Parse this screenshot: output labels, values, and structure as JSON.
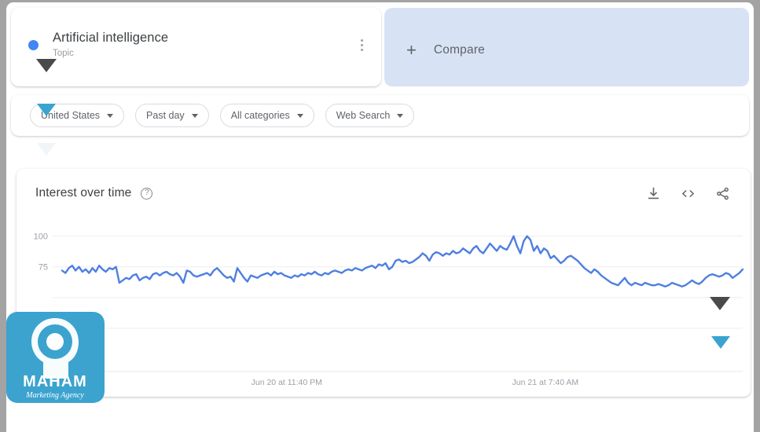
{
  "topbar": {
    "term": {
      "title": "Artificial intelligence",
      "subtitle": "Topic",
      "dot_color": "#4285f4",
      "menu_icon": "kebab-menu-icon"
    },
    "compare": {
      "label": "Compare",
      "plus": "+",
      "background": "#d7e3f4"
    }
  },
  "filters": [
    {
      "label": "United States",
      "caret": "▾"
    },
    {
      "label": "Past day",
      "caret": "▾"
    },
    {
      "label": "All categories",
      "caret": "▾"
    },
    {
      "label": "Web Search",
      "caret": "▾"
    }
  ],
  "chart_card": {
    "title": "Interest over time",
    "help": "?",
    "actions": [
      {
        "name": "download-icon"
      },
      {
        "name": "embed-code-icon"
      },
      {
        "name": "share-icon"
      }
    ]
  },
  "cursors": [
    {
      "name": "cursor-triangle-term",
      "color": "#4a4a4a"
    },
    {
      "name": "cursor-triangle-region",
      "color": "#3ba3d0"
    },
    {
      "name": "cursor-triangle-below-filters",
      "color": "#f2f5f8"
    },
    {
      "name": "cursor-triangle-plot-dark",
      "color": "#4a4a4a"
    },
    {
      "name": "cursor-triangle-plot-blue",
      "color": "#3ba3d0"
    }
  ],
  "watermark": {
    "brand": "MAHAM",
    "tagline": "Marketing Agency",
    "color": "#3ba3ce"
  },
  "chart_data": {
    "type": "line",
    "title": "Interest over time",
    "xlabel": "",
    "ylabel": "",
    "ylim": [
      0,
      110
    ],
    "yticks": [
      75,
      100
    ],
    "ytick_labels": [
      "75",
      "100"
    ],
    "grid": true,
    "legend": false,
    "line_color": "#4e7fe0",
    "xtick_labels": [
      "Jun 20 at 11:40 PM",
      "Jun 21 at 7:40 AM"
    ],
    "xtick_positions": [
      0.33,
      0.71
    ],
    "series": [
      {
        "name": "Artificial intelligence",
        "values": [
          72,
          70,
          74,
          76,
          72,
          75,
          71,
          73,
          70,
          74,
          71,
          76,
          73,
          71,
          74,
          73,
          75,
          62,
          64,
          66,
          65,
          68,
          69,
          64,
          66,
          67,
          65,
          69,
          70,
          68,
          70,
          71,
          69,
          68,
          70,
          67,
          62,
          72,
          71,
          68,
          67,
          68,
          69,
          70,
          68,
          72,
          74,
          71,
          68,
          66,
          67,
          63,
          74,
          70,
          66,
          63,
          68,
          67,
          66,
          68,
          69,
          70,
          68,
          71,
          69,
          70,
          68,
          67,
          66,
          68,
          67,
          69,
          68,
          70,
          69,
          71,
          69,
          68,
          70,
          69,
          71,
          72,
          71,
          70,
          72,
          73,
          72,
          74,
          73,
          72,
          74,
          75,
          76,
          74,
          77,
          76,
          78,
          73,
          75,
          80,
          81,
          79,
          80,
          78,
          79,
          81,
          83,
          86,
          84,
          80,
          85,
          87,
          86,
          84,
          86,
          85,
          88,
          86,
          87,
          90,
          88,
          86,
          90,
          92,
          88,
          86,
          90,
          94,
          91,
          88,
          92,
          90,
          89,
          94,
          100,
          92,
          86,
          96,
          100,
          97,
          88,
          92,
          86,
          90,
          88,
          82,
          84,
          81,
          78,
          80,
          83,
          84,
          82,
          80,
          77,
          74,
          72,
          70,
          73,
          71,
          68,
          66,
          64,
          62,
          61,
          60,
          63,
          66,
          62,
          60,
          62,
          61,
          60,
          62,
          61,
          60,
          60,
          61,
          60,
          59,
          60,
          62,
          61,
          60,
          59,
          60,
          62,
          64,
          62,
          61,
          63,
          66,
          68,
          69,
          68,
          67,
          68,
          70,
          69,
          66,
          68,
          70,
          73
        ]
      }
    ]
  }
}
